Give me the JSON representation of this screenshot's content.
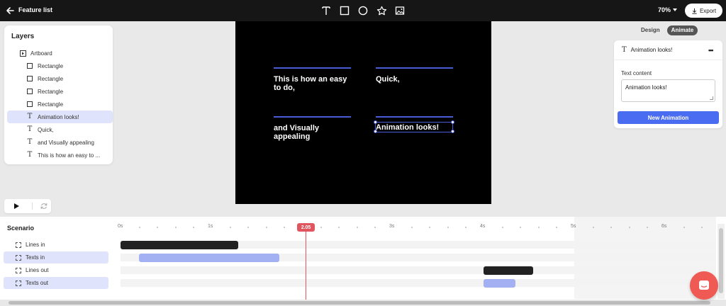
{
  "topbar": {
    "title": "Feature list",
    "zoom": "70%",
    "export_label": "Export",
    "tools": [
      "text-tool-icon",
      "rectangle-tool-icon",
      "ellipse-tool-icon",
      "star-tool-icon",
      "image-tool-icon"
    ]
  },
  "layers": {
    "title": "Layers",
    "items": [
      {
        "label": "Artboard",
        "icon": "artboard-icon"
      },
      {
        "label": "Rectangle",
        "icon": "rectangle-icon"
      },
      {
        "label": "Rectangle",
        "icon": "rectangle-icon"
      },
      {
        "label": "Rectangle",
        "icon": "rectangle-icon"
      },
      {
        "label": "Rectangle",
        "icon": "rectangle-icon"
      },
      {
        "label": "Animation looks!",
        "icon": "text-icon",
        "selected": true
      },
      {
        "label": "Quick,",
        "icon": "text-icon"
      },
      {
        "label": "and Visually appealing",
        "icon": "text-icon"
      },
      {
        "label": "This is how an easy to ...",
        "icon": "text-icon"
      }
    ]
  },
  "artboard": {
    "text1": "This is how an easy to do,",
    "text2": "Quick,",
    "text3": "and Visually appealing",
    "text4": "Animation looks!",
    "line_color": "#4a5bd6"
  },
  "tabs": {
    "design": "Design",
    "animate": "Animate",
    "active": "animate"
  },
  "props": {
    "layer_name": "Animation looks!",
    "field_label": "Text content",
    "text_value": "Animation looks!",
    "button_label": "New Animation"
  },
  "timeline": {
    "title": "Scenario",
    "ticks": [
      "0s",
      "1s",
      "2s",
      "3s",
      "4s",
      "5s",
      "6s"
    ],
    "current_time": "2.05",
    "tracks": [
      {
        "label": "Lines in",
        "selected": false
      },
      {
        "label": "Texts in",
        "selected": true
      },
      {
        "label": "Lines out",
        "selected": false
      },
      {
        "label": "Texts out",
        "selected": true
      }
    ],
    "bars": [
      {
        "track": 0,
        "start_s": 0.0,
        "end_s": 1.3,
        "color": "#222222"
      },
      {
        "track": 1,
        "start_s": 0.2,
        "end_s": 1.75,
        "color": "#a3b1f3"
      },
      {
        "track": 2,
        "start_s": 4.0,
        "end_s": 4.55,
        "color": "#222222"
      },
      {
        "track": 3,
        "start_s": 4.0,
        "end_s": 4.35,
        "color": "#a3b1f3"
      }
    ],
    "playhead_color": "#e0555e"
  },
  "colors": {
    "accent": "#4a6cf0",
    "topbar": "#161616",
    "chat": "#ef5a55"
  }
}
